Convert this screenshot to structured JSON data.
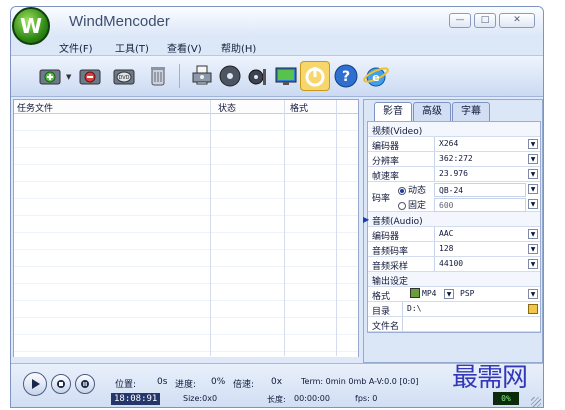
{
  "app": {
    "title": "WindMencoder"
  },
  "menu": [
    "文件(F)",
    "工具(T)",
    "查看(V)",
    "帮助(H)"
  ],
  "window_buttons": [
    "—",
    "□",
    "✕"
  ],
  "task_list": {
    "columns": [
      "任务文件",
      "状态",
      "格式"
    ]
  },
  "tabs": [
    "影音",
    "高级",
    "字幕"
  ],
  "video": {
    "section": "视频(Video)",
    "codec_label": "编码器",
    "codec": "X264",
    "resolution_label": "分辨率",
    "resolution": "362:272",
    "fps_label": "帧速率",
    "fps": "23.976",
    "bitrate_label": "码率",
    "mode_dynamic": "动态",
    "dynamic_value": "QB-24",
    "mode_fixed": "固定",
    "fixed_value": "600"
  },
  "audio": {
    "section": "音频(Audio)",
    "codec_label": "编码器",
    "codec": "AAC",
    "bitrate_label": "音频码率",
    "bitrate": "128",
    "samplerate_label": "音频采样",
    "samplerate": "44100"
  },
  "output": {
    "section": "输出设定",
    "format_label": "格式",
    "format": "MP4",
    "preset": "PSP",
    "dir_label": "目录",
    "dir": "D:\\",
    "filename_label": "文件名",
    "filename": ""
  },
  "status": {
    "pos_label": "位置:",
    "pos": "0s",
    "progress_label": "进度:",
    "progress": "0%",
    "speed_label": "倍速:",
    "speed": "0x",
    "term": "Term: 0min 0mb A-V:0.0 [0:0]",
    "time": "18:08:91",
    "size": "Size:0x0",
    "length_label": "长度:",
    "length": "00:00:00",
    "fps": "fps: 0",
    "percent": "0%"
  },
  "watermark": "最需网",
  "colors": {
    "accent": "#1a3ea8",
    "panel": "#dbe6f6",
    "titlebar": "#dbe6f7",
    "percent_bg": "#0c2a0c",
    "percent_fg": "#7ff07f"
  }
}
